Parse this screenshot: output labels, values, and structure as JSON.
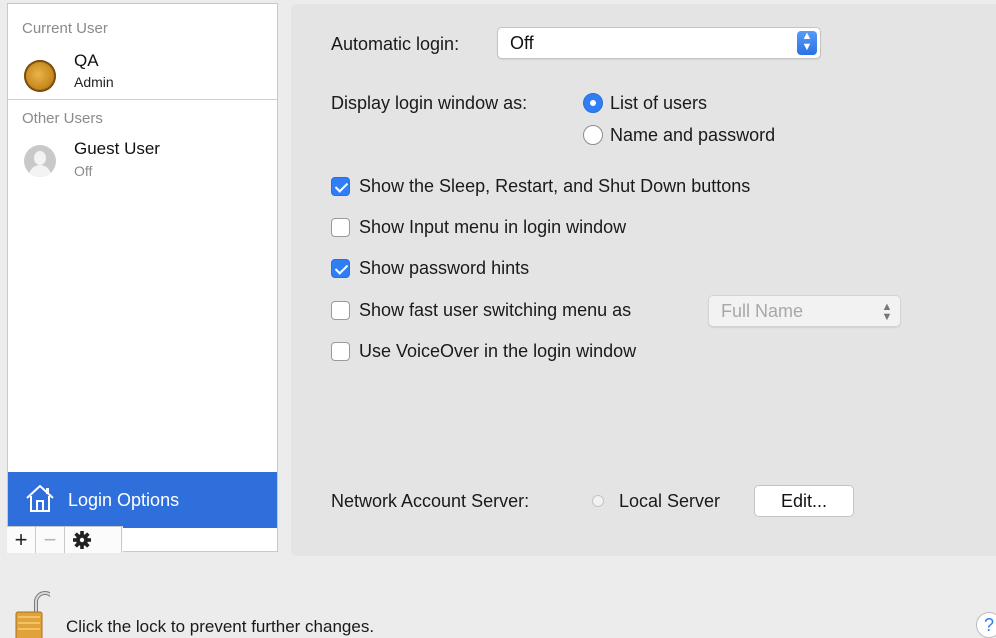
{
  "sidebar": {
    "current_user_header": "Current User",
    "current_user": {
      "name": "QA",
      "role": "Admin"
    },
    "other_users_header": "Other Users",
    "other_users": [
      {
        "name": "Guest User",
        "status": "Off"
      }
    ],
    "login_options_label": "Login Options",
    "toolbar": {
      "add": "+",
      "remove": "−",
      "action_icon": "gear-icon"
    }
  },
  "login": {
    "automatic_login_label": "Automatic login:",
    "automatic_login_value": "Off",
    "display_as_label": "Display login window as:",
    "display_options": [
      {
        "label": "List of users",
        "selected": true
      },
      {
        "label": "Name and password",
        "selected": false
      }
    ],
    "checkboxes": [
      {
        "label": "Show the Sleep, Restart, and Shut Down buttons",
        "checked": true
      },
      {
        "label": "Show Input menu in login window",
        "checked": false
      },
      {
        "label": "Show password hints",
        "checked": true
      },
      {
        "label": "Show fast user switching menu as",
        "checked": false
      },
      {
        "label": "Use VoiceOver in the login window",
        "checked": false
      }
    ],
    "fast_switch_value": "Full Name",
    "network_server_label": "Network Account Server:",
    "network_server_value": "Local Server",
    "edit_button": "Edit..."
  },
  "footer": {
    "lock_text": "Click the lock to prevent further changes.",
    "help_label": "?"
  },
  "colors": {
    "accent": "#2f6fdc",
    "check_blue": "#2f7ef3",
    "lock_gold": "#e2a23a"
  }
}
